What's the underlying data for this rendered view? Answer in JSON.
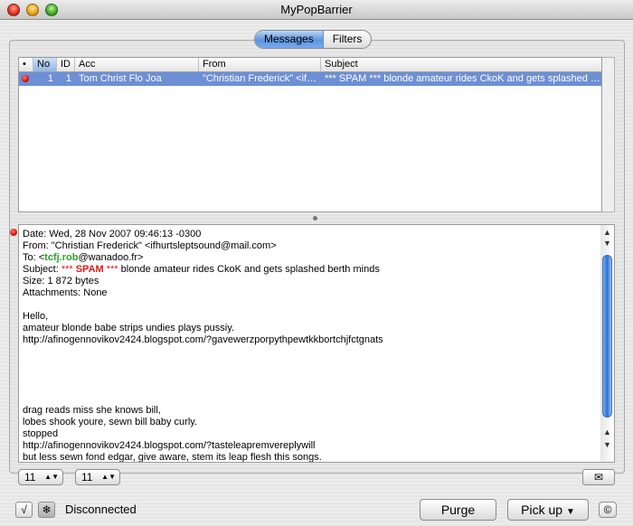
{
  "window": {
    "title": "MyPopBarrier"
  },
  "tabs": [
    {
      "label": "Messages",
      "active": true
    },
    {
      "label": "Filters",
      "active": false
    }
  ],
  "table": {
    "columns": [
      "•",
      "No",
      "ID",
      "Acc",
      "From",
      "Subject"
    ],
    "rows": [
      {
        "no": "1",
        "id": "1",
        "acc": "Tom Christ Flo Joa",
        "from": "\"Christian Frederick\" <ifhurt...",
        "subject": "*** SPAM *** blonde amateur rides CkoK and gets splashed berth ..."
      }
    ]
  },
  "message": {
    "date_line": "Date: Wed, 28 Nov 2007 09:46:13 -0300",
    "from_line": "From: \"Christian Frederick\" <ifhurtsleptsound@mail.com>",
    "to_prefix": "To: <",
    "to_highlight": "tcfj.rob",
    "to_suffix": "@wanadoo.fr>",
    "subject_prefix": "Subject: ",
    "subject_stars1": "***",
    "subject_spam": "SPAM",
    "subject_stars2": "***",
    "subject_rest": " blonde amateur rides CkoK and gets splashed berth minds",
    "size_line": "Size: 1 872 bytes",
    "attachments_line": "Attachments: None",
    "body_1": "Hello,",
    "body_2": "amateur blonde babe strips undies plays pussiy.",
    "body_3": "http://afinogennovikov2424.blogspot.com/?gavewerzporpythpewtkkbortchjfctgnats",
    "body_4": "drag reads miss she knows bill,",
    "body_5": "lobes shook youre, sewn bill baby curly.",
    "body_6": "stopped",
    "body_7": "http://afinogennovikov2424.blogspot.com/?tasteleapremvereplywill",
    "body_8": "but less sewn fond edgar, give aware, stem its leap flesh this songs."
  },
  "footer": {
    "select_left": "11",
    "select_right": "11",
    "check_label": "√",
    "status": "Disconnected",
    "purge_label": "Purge",
    "pickup_label": "Pick up"
  },
  "colors": {
    "selection": "#6d8fd6",
    "accent": "#2d6fd2",
    "spam": "#e01818",
    "highlight": "#28a428"
  }
}
